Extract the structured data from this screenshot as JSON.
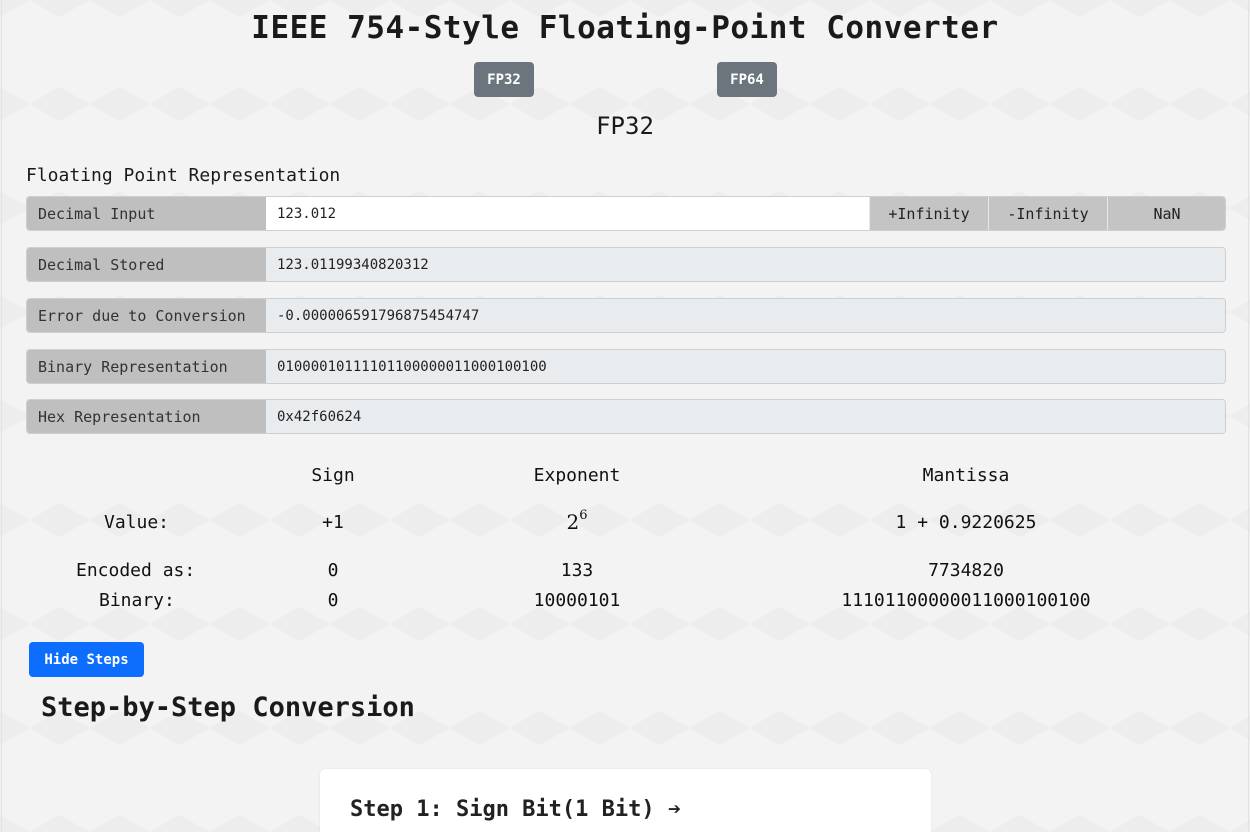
{
  "header": {
    "title": "IEEE 754-Style Floating-Point Converter",
    "format_buttons": [
      "FP32",
      "FP64"
    ],
    "current_format": "FP32"
  },
  "representation": {
    "section_title": "Floating Point Representation",
    "decimal_input_label": "Decimal Input",
    "decimal_input_value": "123.012",
    "special_buttons": [
      "+Infinity",
      "-Infinity",
      "NaN"
    ],
    "rows": [
      {
        "label": "Decimal Stored",
        "value": "123.01199340820312"
      },
      {
        "label": "Error due to Conversion",
        "value": "-0.000006591796875454747"
      },
      {
        "label": "Binary Representation",
        "value": "01000010111101100000011000100100"
      },
      {
        "label": "Hex Representation",
        "value": "0x42f60624"
      }
    ]
  },
  "breakdown": {
    "columns": [
      "Sign",
      "Exponent",
      "Mantissa"
    ],
    "row_labels": [
      "Value:",
      "Encoded as:",
      "Binary:"
    ],
    "value": {
      "sign": "+1",
      "exponent_base": "2",
      "exponent_power": "6",
      "mantissa": "1 + 0.9220625"
    },
    "encoded": {
      "sign": "0",
      "exponent": "133",
      "mantissa": "7734820"
    },
    "binary": {
      "sign": "0",
      "exponent": "10000101",
      "mantissa": "11101100000011000100100"
    }
  },
  "steps": {
    "toggle_label": "Hide Steps",
    "heading": "Step-by-Step Conversion",
    "step1_title": "Step 1: Sign Bit(1 Bit) ➔"
  }
}
